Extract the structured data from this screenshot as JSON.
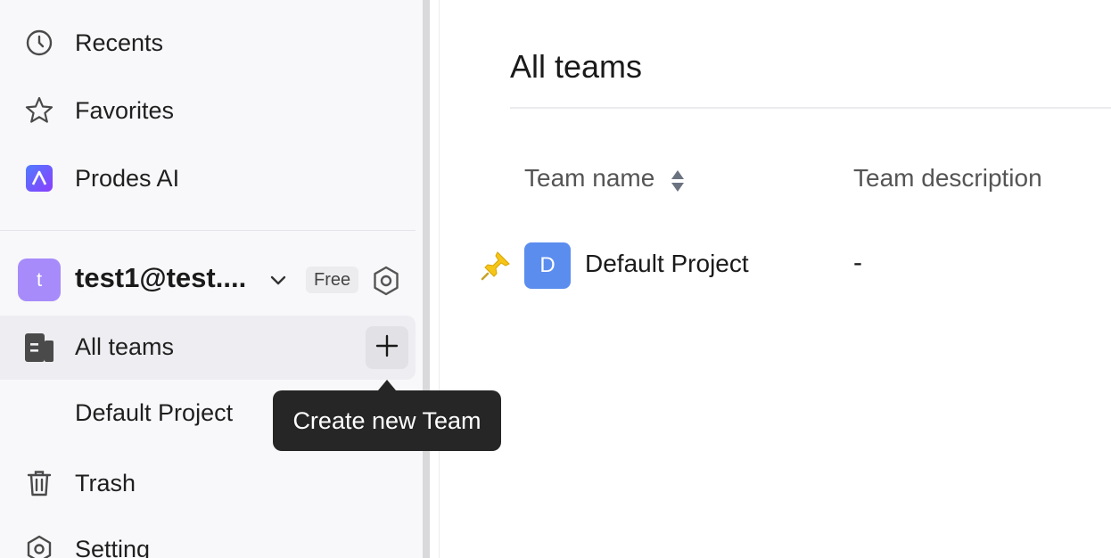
{
  "sidebar": {
    "nav": [
      {
        "label": "Recents",
        "icon": "clock-icon"
      },
      {
        "label": "Favorites",
        "icon": "star-icon"
      },
      {
        "label": "Prodes AI",
        "icon": "prodes-ai-icon"
      }
    ],
    "workspace": {
      "avatar_letter": "t",
      "name": "test1@test....",
      "plan_badge": "Free"
    },
    "teams": {
      "label": "All teams",
      "tooltip": "Create new Team",
      "items": [
        "Default Project"
      ]
    },
    "trash_label": "Trash",
    "setting_label": "Setting"
  },
  "main": {
    "title": "All teams",
    "columns": {
      "name": "Team name",
      "description": "Team description"
    },
    "rows": [
      {
        "avatar_letter": "D",
        "name": "Default Project",
        "description": "-"
      }
    ]
  },
  "colors": {
    "workspace_avatar": "#a78bfa",
    "team_avatar": "#5b8def",
    "tooltip_bg": "#262626"
  }
}
